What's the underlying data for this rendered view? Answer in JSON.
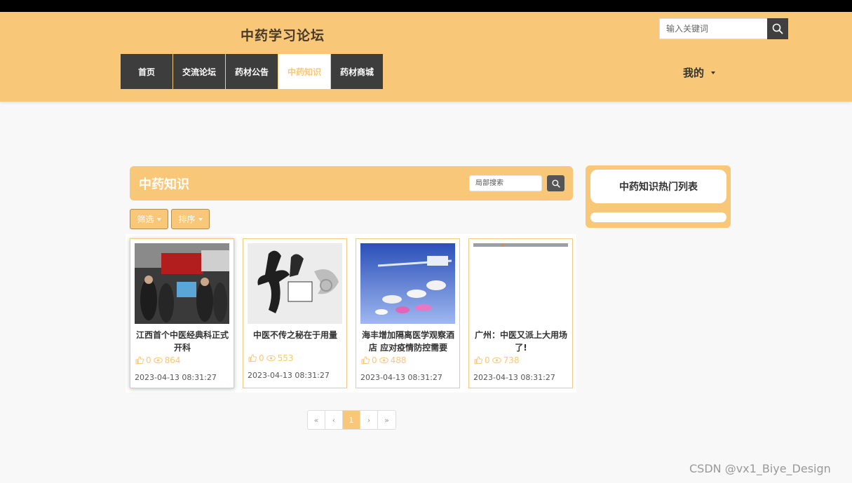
{
  "header": {
    "site_title": "中药学习论坛",
    "search_placeholder": "输入关键词",
    "nav": [
      "首页",
      "交流论坛",
      "药材公告",
      "中药知识",
      "药材商城"
    ],
    "active_nav": "中药知识",
    "user_menu": "我的"
  },
  "section": {
    "title": "中药知识",
    "local_search_placeholder": "局部搜索",
    "filter_label": "筛选",
    "sort_label": "排序"
  },
  "cards": [
    {
      "title": "江西首个中医经典科正式开科",
      "likes": "0",
      "views": "864",
      "date": "2023-04-13 08:31:27"
    },
    {
      "title": "中医不传之秘在于用量",
      "likes": "0",
      "views": "553",
      "date": "2023-04-13 08:31:27"
    },
    {
      "title": "海丰增加隔离医学观察酒店 应对疫情防控需要",
      "likes": "0",
      "views": "488",
      "date": "2023-04-13 08:31:27"
    },
    {
      "title": "广州：中医又派上大用场了!",
      "likes": "0",
      "views": "738",
      "date": "2023-04-13 08:31:27"
    }
  ],
  "pagination": {
    "first": "«",
    "prev": "‹",
    "current": "1",
    "next": "›",
    "last": "»"
  },
  "sidebar": {
    "title": "中药知识热门列表"
  },
  "watermark": "CSDN @vx1_Biye_Design",
  "colors": {
    "accent": "#f8c777",
    "nav_bg": "#3d3d3d"
  }
}
